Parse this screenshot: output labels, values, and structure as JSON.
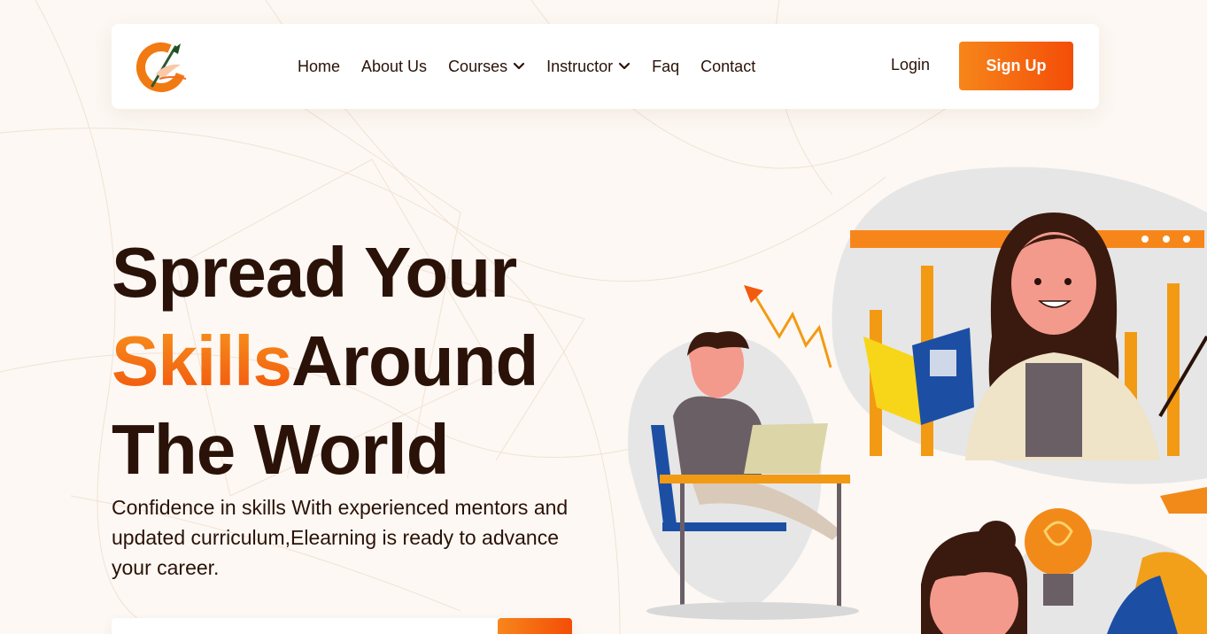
{
  "nav": {
    "items": [
      {
        "label": "Home",
        "dropdown": false
      },
      {
        "label": "About Us",
        "dropdown": false
      },
      {
        "label": "Courses",
        "dropdown": true
      },
      {
        "label": "Instructor",
        "dropdown": true
      },
      {
        "label": "Faq",
        "dropdown": false
      },
      {
        "label": "Contact",
        "dropdown": false
      }
    ],
    "login_label": "Login",
    "signup_label": "Sign Up"
  },
  "hero": {
    "title_line1": "Spread Your",
    "title_accent": "Skills",
    "title_line2_rest": "Around",
    "title_line3": "The World",
    "description": "Confidence in skills With experienced mentors and updated curriculum,Elearning is ready to advance your career."
  },
  "colors": {
    "accent_start": "#f7861a",
    "accent_end": "#f44d08",
    "heading": "#2a1208",
    "background": "#fdf8f3"
  },
  "icons": {
    "logo": "brand-logo-icon",
    "dropdown": "chevron-down-icon"
  }
}
